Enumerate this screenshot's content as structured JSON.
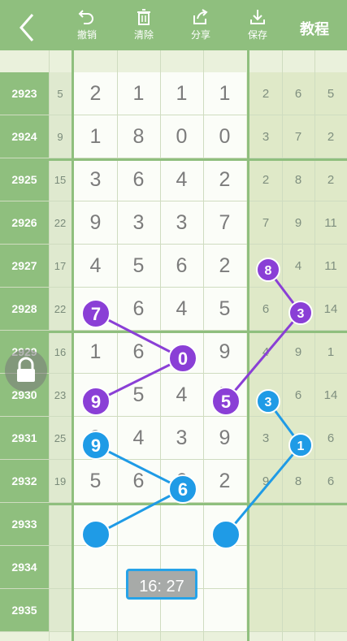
{
  "toolbar": {
    "undo_label": "撤销",
    "clear_label": "清除",
    "share_label": "分享",
    "save_label": "保存",
    "tutorial_label": "教程"
  },
  "colors": {
    "toolbar": "#8fbf7e",
    "purple": "#8a3fd6",
    "blue": "#1f9be6"
  },
  "rows": [
    {
      "issue": "2923",
      "sum": "5",
      "digits": [
        "2",
        "1",
        "1",
        "1"
      ],
      "stats": [
        "2",
        "6",
        "5"
      ]
    },
    {
      "issue": "2924",
      "sum": "9",
      "digits": [
        "1",
        "8",
        "0",
        "0"
      ],
      "stats": [
        "3",
        "7",
        "2"
      ]
    },
    {
      "issue": "2925",
      "sum": "15",
      "digits": [
        "3",
        "6",
        "4",
        "2"
      ],
      "stats": [
        "2",
        "8",
        "2"
      ]
    },
    {
      "issue": "2926",
      "sum": "22",
      "digits": [
        "9",
        "3",
        "3",
        "7"
      ],
      "stats": [
        "7",
        "9",
        "11"
      ]
    },
    {
      "issue": "2927",
      "sum": "17",
      "digits": [
        "4",
        "5",
        "6",
        "2"
      ],
      "stats": [
        "8",
        "4",
        "11"
      ]
    },
    {
      "issue": "2928",
      "sum": "22",
      "digits": [
        "7",
        "6",
        "4",
        "5"
      ],
      "stats": [
        "6",
        "3",
        "14"
      ]
    },
    {
      "issue": "2929",
      "sum": "16",
      "digits": [
        "1",
        "6",
        "0",
        "9"
      ],
      "stats": [
        "4",
        "9",
        "1"
      ]
    },
    {
      "issue": "2930",
      "sum": "23",
      "digits": [
        "9",
        "5",
        "4",
        "5"
      ],
      "stats": [
        "3",
        "6",
        "14"
      ]
    },
    {
      "issue": "2931",
      "sum": "25",
      "digits": [
        "9",
        "4",
        "3",
        "9"
      ],
      "stats": [
        "3",
        "1",
        "6"
      ]
    },
    {
      "issue": "2932",
      "sum": "19",
      "digits": [
        "5",
        "6",
        "6",
        "2"
      ],
      "stats": [
        "9",
        "8",
        "6"
      ]
    },
    {
      "issue": "2933",
      "sum": "",
      "digits": [
        "",
        "",
        "",
        ""
      ],
      "stats": [
        "",
        "",
        ""
      ]
    },
    {
      "issue": "2934",
      "sum": "",
      "digits": [
        "",
        "",
        "",
        ""
      ],
      "stats": [
        "",
        "",
        ""
      ]
    },
    {
      "issue": "2935",
      "sum": "",
      "digits": [
        "",
        "",
        "",
        ""
      ],
      "stats": [
        "",
        "",
        ""
      ]
    }
  ],
  "timer": "16:  27"
}
